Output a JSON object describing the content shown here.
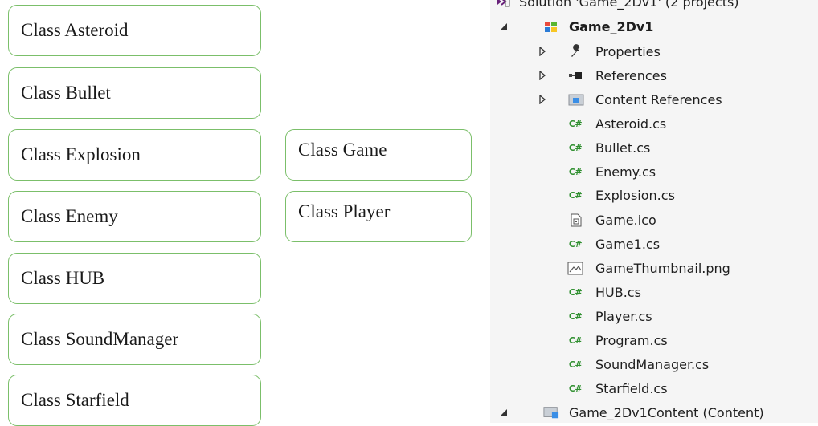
{
  "left_classes": [
    "Class Asteroid",
    "Class Bullet",
    "Class Explosion",
    "Class Enemy",
    "Class HUB",
    "Class SoundManager",
    "Class Starfield"
  ],
  "right_classes": [
    "Class Game",
    "Class Player"
  ],
  "solution_explorer": {
    "solution_label": "Solution 'Game_2Dv1' (2 projects)",
    "project_label": "Game_2Dv1",
    "properties_label": "Properties",
    "references_label": "References",
    "content_references_label": "Content References",
    "csharp_badge": "C#",
    "files": [
      {
        "name": "Asteroid.cs",
        "icon": "csharp-file-icon"
      },
      {
        "name": "Bullet.cs",
        "icon": "csharp-file-icon"
      },
      {
        "name": "Enemy.cs",
        "icon": "csharp-file-icon"
      },
      {
        "name": "Explosion.cs",
        "icon": "csharp-file-icon"
      },
      {
        "name": "Game.ico",
        "icon": "ico-file-icon"
      },
      {
        "name": "Game1.cs",
        "icon": "csharp-file-icon"
      },
      {
        "name": "GameThumbnail.png",
        "icon": "image-file-icon"
      },
      {
        "name": "HUB.cs",
        "icon": "csharp-file-icon"
      },
      {
        "name": "Player.cs",
        "icon": "csharp-file-icon"
      },
      {
        "name": "Program.cs",
        "icon": "csharp-file-icon"
      },
      {
        "name": "SoundManager.cs",
        "icon": "csharp-file-icon"
      },
      {
        "name": "Starfield.cs",
        "icon": "csharp-file-icon"
      }
    ],
    "content_project_label": "Game_2Dv1Content (Content)"
  }
}
